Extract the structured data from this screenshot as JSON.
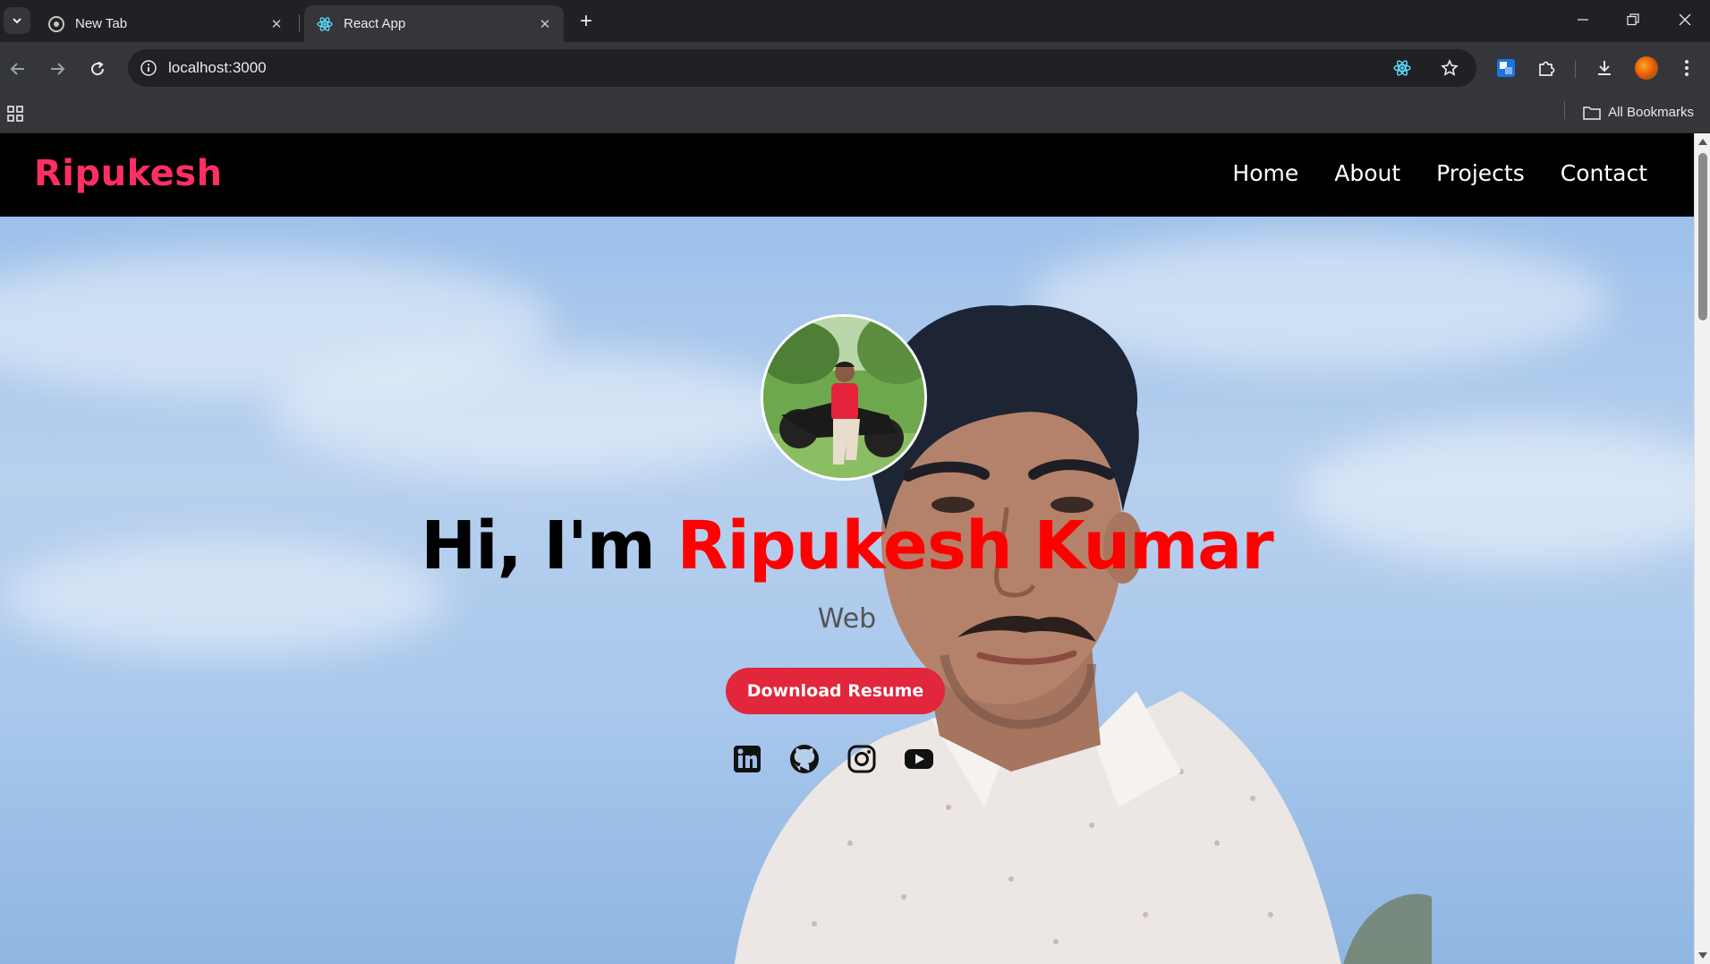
{
  "browser": {
    "tabs": [
      {
        "title": "New Tab",
        "active": false
      },
      {
        "title": "React App",
        "active": true
      }
    ],
    "url": "localhost:3000",
    "bookmarks_label": "All Bookmarks"
  },
  "site": {
    "brand": "Ripukesh",
    "nav": [
      "Home",
      "About",
      "Projects",
      "Contact"
    ],
    "hero": {
      "greeting_prefix": "Hi, I'm",
      "name": "Ripukesh Kumar",
      "subtitle": "Web",
      "resume_button": "Download Resume",
      "socials": [
        "linkedin-icon",
        "github-icon",
        "instagram-icon",
        "youtube-icon"
      ]
    }
  },
  "colors": {
    "brand": "#ff2e63",
    "name_highlight": "#ff0000",
    "button": "#e2263b"
  }
}
